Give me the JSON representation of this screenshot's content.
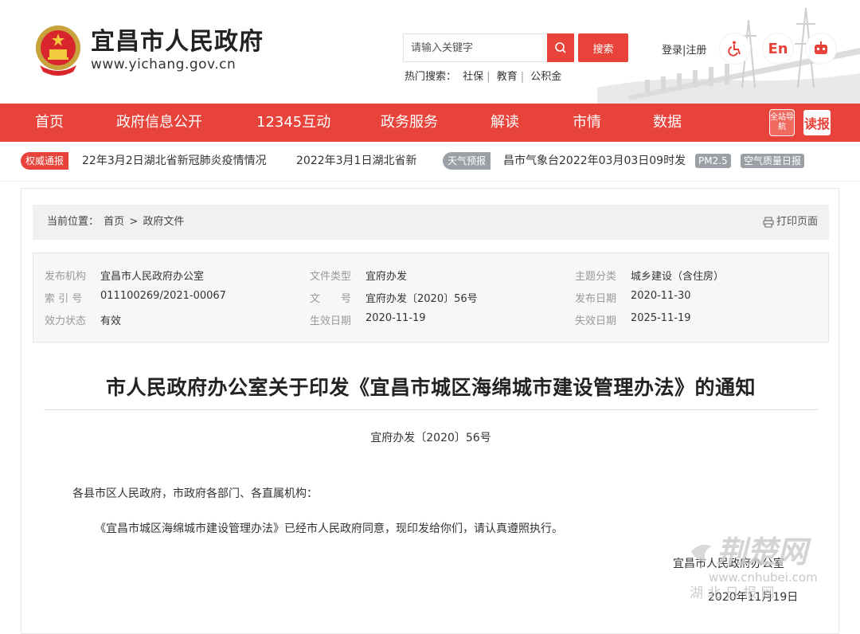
{
  "header": {
    "title": "宜昌市人民政府",
    "url": "www.yichang.gov.cn",
    "search_placeholder": "请输入关键字",
    "search_button": "搜索",
    "hot_label": "热门搜索：",
    "hot_terms": [
      "社保",
      "教育",
      "公积金"
    ],
    "login": "登录",
    "divider": "|",
    "register": "注册",
    "english": "En"
  },
  "nav": {
    "items": [
      "首页",
      "政府信息公开",
      "12345互动",
      "政务服务",
      "解读",
      "市情",
      "数据"
    ],
    "guide_label": "全站导航",
    "read_label": "读报"
  },
  "ticker": {
    "tag1": "权威通报",
    "news1": "22年3月2日湖北省新冠肺炎疫情情况",
    "news2": "2022年3月1日湖北省新",
    "tag2": "天气预报",
    "weather": "昌市气象台2022年03月03日09时发",
    "pm": "PM2.5",
    "aqi": "空气质量日报"
  },
  "breadcrumb": {
    "label": "当前位置：",
    "home": "首页",
    "sep": ">",
    "current": "政府文件",
    "print": "打印页面"
  },
  "meta": {
    "publisher_label": "发布机构",
    "publisher": "宜昌市人民政府办公室",
    "index_label": "索 引 号",
    "index": "011100269/2021-00067",
    "validity_label": "效力状态",
    "validity": "有效",
    "type_label": "文件类型",
    "type": "宜府办发",
    "docno_label": "文　　号",
    "docno": "宜府办发〔2020〕56号",
    "effective_label": "生效日期",
    "effective": "2020-11-19",
    "topic_label": "主题分类",
    "topic": "城乡建设（含住房）",
    "pubdate_label": "发布日期",
    "pubdate": "2020-11-30",
    "expire_label": "失效日期",
    "expire": "2025-11-19"
  },
  "document": {
    "title": "市人民政府办公室关于印发《宜昌市城区海绵城市建设管理办法》的通知",
    "number": "宜府办发〔2020〕56号",
    "salutation": "各县市区人民政府，市政府各部门、各直属机构：",
    "body": "《宜昌市城区海绵城市建设管理办法》已经市人民政府同意，现印发给你们，请认真遵照执行。",
    "signature": "宜昌市人民政府办公室",
    "date": "2020年11月19日"
  },
  "watermark": {
    "name": "荆楚网",
    "site": "www.cnhubei.com",
    "sub": "湖 北 日 报 网"
  }
}
